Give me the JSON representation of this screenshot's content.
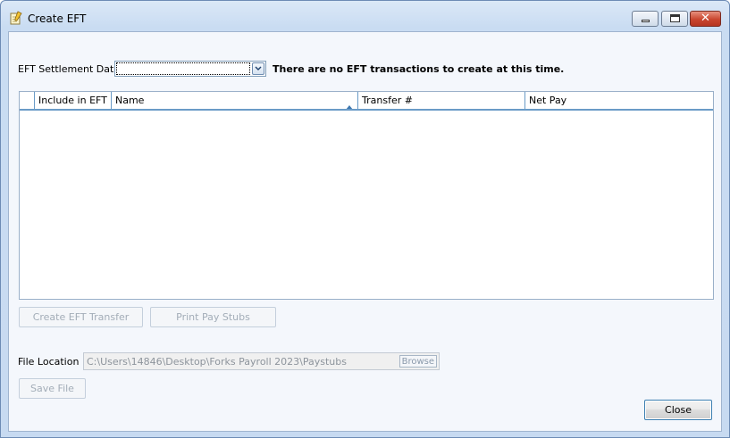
{
  "window": {
    "title": "Create EFT",
    "controls": {
      "minimize": "minimize",
      "maximize": "maximize",
      "close": "close"
    }
  },
  "settlement": {
    "label": "EFT Settlement Date",
    "value": "",
    "message": "There are no EFT transactions to create at this time."
  },
  "grid": {
    "columns": [
      {
        "key": "select",
        "label": ""
      },
      {
        "key": "include",
        "label": "Include in EFT"
      },
      {
        "key": "name",
        "label": "Name",
        "sort": "ascending"
      },
      {
        "key": "transfer",
        "label": "Transfer #"
      },
      {
        "key": "netpay",
        "label": "Net Pay"
      }
    ],
    "rows": []
  },
  "actions": {
    "create_transfer": "Create EFT Transfer",
    "print_stubs": "Print Pay Stubs"
  },
  "file": {
    "label": "File Location",
    "path": "C:\\Users\\14846\\Desktop\\Forks Payroll 2023\\Paystubs",
    "browse": "Browse",
    "save": "Save File"
  },
  "footer": {
    "close": "Close"
  },
  "colors": {
    "header_rule": "#6a9bc7",
    "title_gradient_top": "#dbe8f7",
    "close_button": "#c9452e"
  }
}
